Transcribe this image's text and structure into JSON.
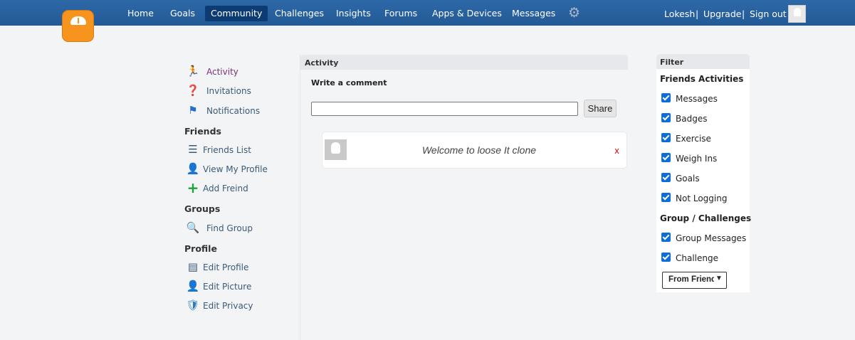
{
  "topbar": {
    "nav": [
      "Home",
      "Goals",
      "Community",
      "Challenges",
      "Insights",
      "Forums",
      "Apps & Devices",
      "Messages"
    ],
    "active_nav": "Community",
    "user": "Lokesh",
    "sep": "|",
    "upgrade": "Upgrade",
    "signout": "Sign out"
  },
  "sidebar": {
    "activity": "Activity",
    "invitations": "Invitations",
    "notifications": "Notifications",
    "friends_heading": "Friends",
    "friends_list": "Friends List",
    "view_profile": "View My Profile",
    "add_friend": "Add Freind",
    "groups_heading": "Groups",
    "find_group": "Find Group",
    "profile_heading": "Profile",
    "edit_profile": "Edit Profile",
    "edit_picture": "Edit Picture",
    "edit_privacy": "Edit Privacy"
  },
  "activity": {
    "header": "Activity",
    "write_label": "Write a comment",
    "comment_value": "",
    "share_label": "Share",
    "post_message": "Welcome to loose It clone",
    "post_close": "x"
  },
  "filter": {
    "header": "Filter",
    "friends_heading": "Friends Activities",
    "friends_items": [
      "Messages",
      "Badges",
      "Exercise",
      "Weigh Ins",
      "Goals",
      "Not Logging"
    ],
    "group_heading": "Group / Challenges",
    "group_items": [
      "Group Messages",
      "Challenge"
    ],
    "select_value": "From Friends"
  },
  "colors": {
    "topbar": "#235a96",
    "active_nav": "#0c3c73",
    "logo": "#f7941d",
    "checkbox": "#0b6dd8",
    "close_x": "#dd1111",
    "activity_link": "#7a3278"
  }
}
